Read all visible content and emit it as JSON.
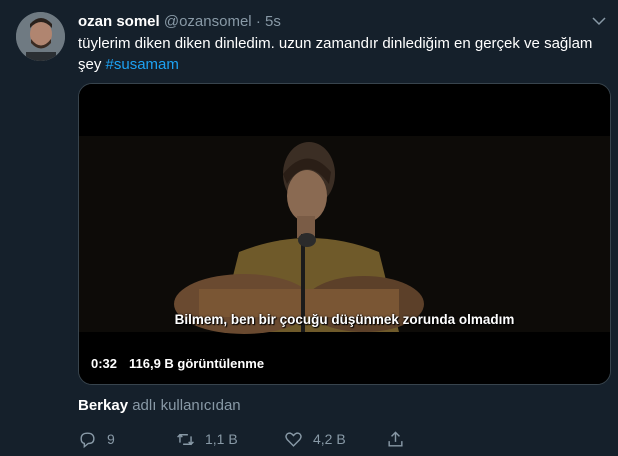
{
  "tweet": {
    "author_name": "ozan somel",
    "author_handle": "@ozansomel",
    "separator": "·",
    "time": "5s",
    "text": "tüylerim diken diken dinledim. uzun zamandır dinlediğim en gerçek ve sağlam şey ",
    "hashtag": "#susamam"
  },
  "media": {
    "subtitle": "Bilmem, ben bir çocuğu düşünmek zorunda olmadım",
    "duration": "0:32",
    "views": "116,9 B görüntülenme"
  },
  "social_context": {
    "user": "Berkay",
    "suffix": "adlı kullanıcıdan"
  },
  "actions": {
    "reply_count": "9",
    "retweet_count": "1,1 B",
    "like_count": "4,2 B"
  },
  "colors": {
    "background": "#15202b",
    "accent": "#1da1f2",
    "secondary_text": "#8899a6",
    "border": "#38444d"
  },
  "icons": [
    "reply-icon",
    "retweet-icon",
    "like-icon",
    "share-icon",
    "caret-down-icon"
  ]
}
